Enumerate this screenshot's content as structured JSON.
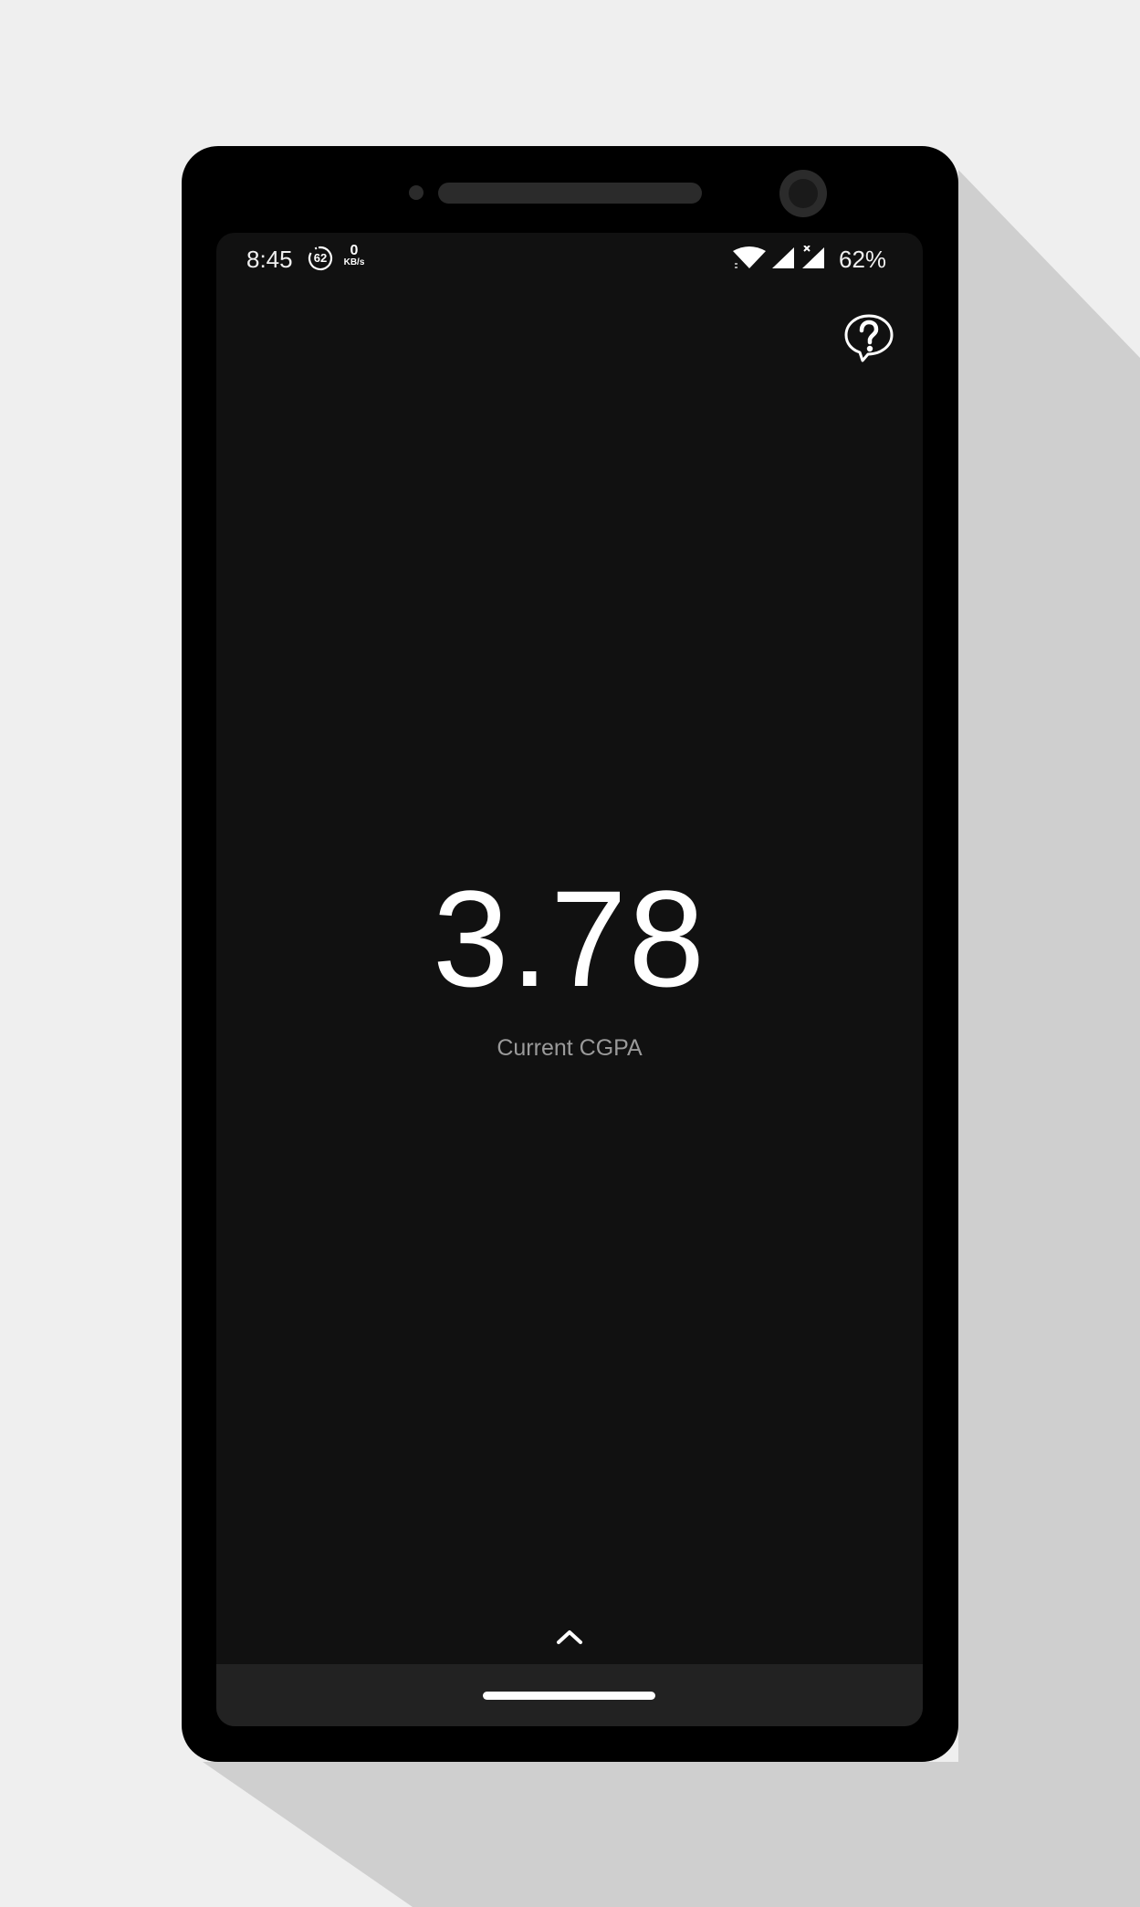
{
  "status_bar": {
    "time": "8:45",
    "data_saver_value": "62",
    "net_speed_value": "0",
    "net_speed_unit": "KB/s",
    "battery": "62%",
    "icons": [
      "data-saver-icon",
      "wifi-icon",
      "cell-signal-icon",
      "cell-signal-no-data-icon"
    ]
  },
  "header": {
    "help_icon": "help-bubble-icon"
  },
  "main": {
    "cgpa_value": "3.78",
    "cgpa_label": "Current CGPA"
  },
  "footer": {
    "expand_icon": "chevron-up-icon",
    "home_icon": "home-handle"
  },
  "colors": {
    "screen_bg": "#111111",
    "phone_body": "#000000",
    "page_bg": "#efefef",
    "shadow": "#cfcfcf",
    "label_text": "#9a9a9a",
    "nav_bar": "#222222"
  }
}
